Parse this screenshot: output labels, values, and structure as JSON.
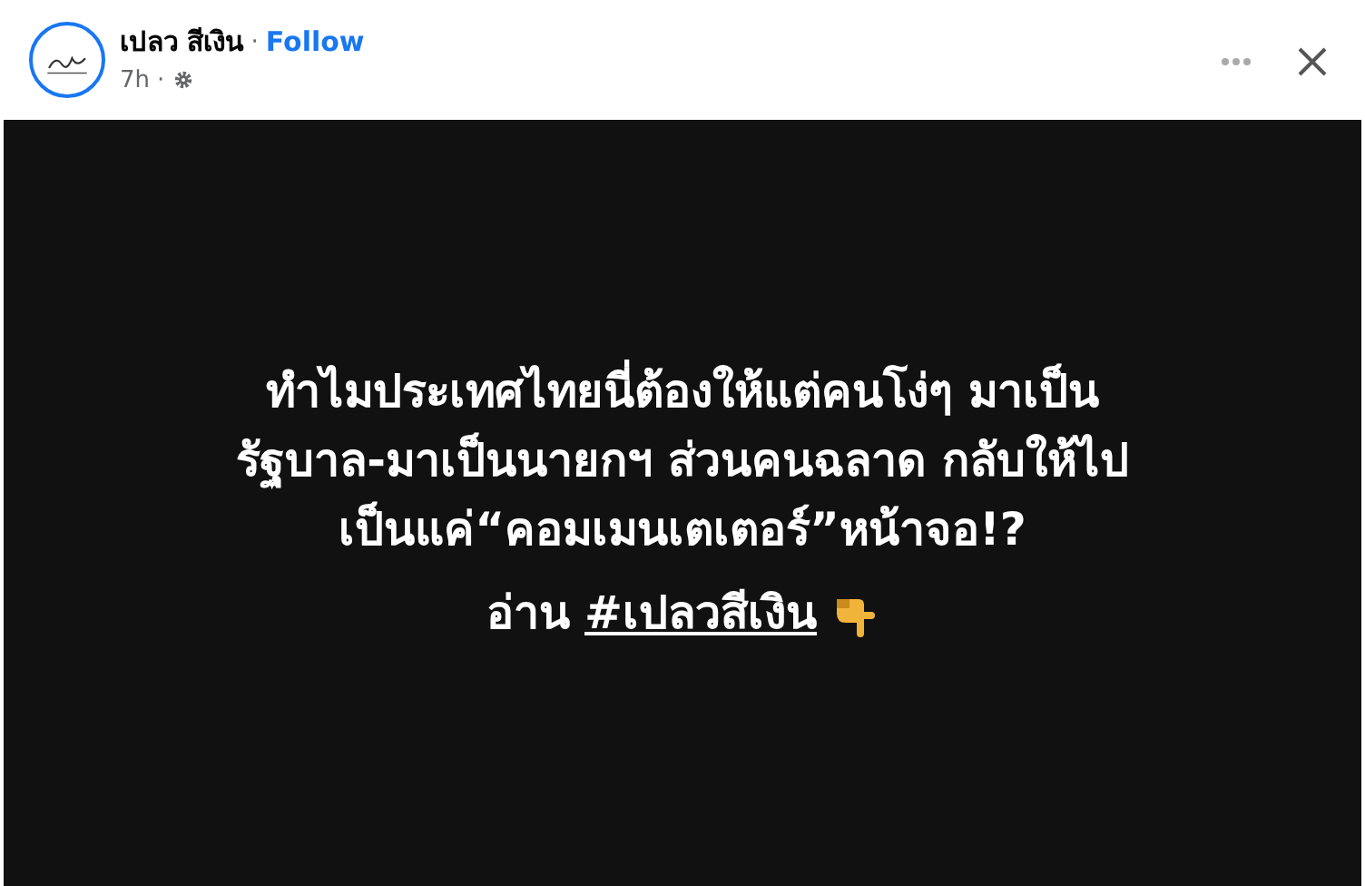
{
  "post": {
    "author": "เปลว สีเงิน",
    "separator": "·",
    "follow": "Follow",
    "time": "7h",
    "time_separator": "·"
  },
  "content": {
    "lines": [
      "ทำไมประเทศไทยนี่ต้องให้แต่คนโง่ๆ มาเป็น",
      "รัฐบาล-มาเป็นนายกฯ ส่วนคนฉลาด กลับให้ไป",
      "เป็นแค่“คอมเมนเตเตอร์”หน้าจอ!?"
    ],
    "read_prefix": "อ่าน",
    "hashtag": "#เปลวสีเงิน"
  }
}
